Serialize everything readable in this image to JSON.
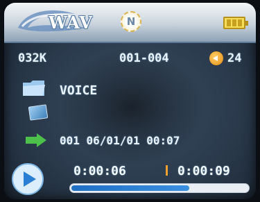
{
  "header": {
    "app_title": "WAV",
    "mode_icon_letter": "N",
    "icons": {
      "logo": "swoosh-logo-icon",
      "battery": "battery-icon"
    }
  },
  "status": {
    "bitrate": "032K",
    "track_range": "001-004",
    "volume": "24",
    "volume_icon": "speaker-icon"
  },
  "folder": {
    "icon": "folder-icon",
    "name": "VOICE"
  },
  "card": {
    "icon": "memory-card-icon"
  },
  "recording": {
    "icon": "arrow-right-icon",
    "info": "001 06/01/01 00:07"
  },
  "playback": {
    "play_icon": "play-icon",
    "elapsed": "0:00:06",
    "total": "0:00:09",
    "progress": 0.67
  },
  "colors": {
    "accent_blue": "#2a7fd4",
    "separator_orange": "#f0a030",
    "battery_yellow": "#f6de5a"
  }
}
